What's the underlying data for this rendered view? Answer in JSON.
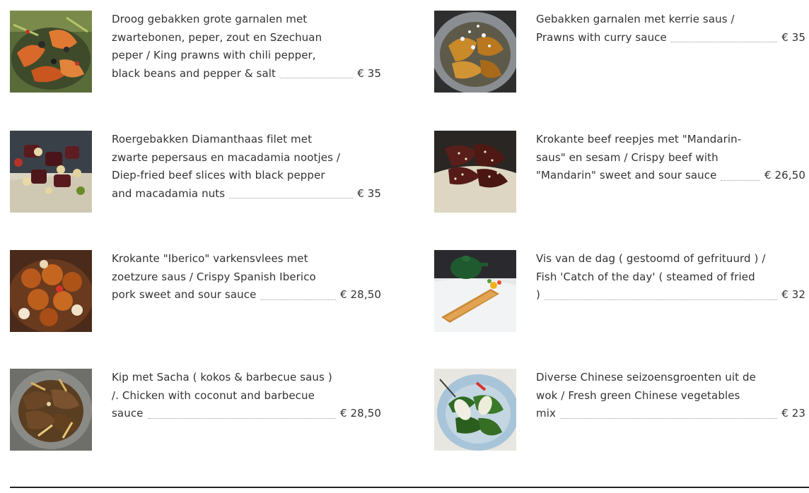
{
  "menu": {
    "items": [
      {
        "id": "garnalen-szechuan",
        "lines": [
          "Droog gebakken grote garnalen met",
          "zwartebonen, peper, zout en Szechuan",
          "peper / King prawns with chili pepper,"
        ],
        "last_line": "black beans and pepper & salt",
        "price": "€ 35",
        "image": "king-prawns-photo"
      },
      {
        "id": "garnalen-kerrie",
        "lines": [
          "Gebakken garnalen met kerrie saus /"
        ],
        "last_line": "Prawns with curry sauce",
        "price": "€ 35",
        "image": "curry-prawns-photo"
      },
      {
        "id": "diamanthaas",
        "lines": [
          "Roergebakken Diamanthaas filet met",
          "zwarte pepersaus en macadamia nootjes /",
          "Diep-fried beef slices with black pepper"
        ],
        "last_line": "and macadamia nuts",
        "price": "€ 35",
        "image": "beef-macadamia-photo"
      },
      {
        "id": "mandarin-beef",
        "lines": [
          "Krokante beef reepjes met \"Mandarin-",
          "saus\" en sesam / Crispy beef with"
        ],
        "last_line": "\"Mandarin\" sweet and sour sauce",
        "price": "€ 26,50",
        "image": "mandarin-beef-photo"
      },
      {
        "id": "iberico",
        "lines": [
          "Krokante \"Iberico\" varkensvlees met",
          "zoetzure saus / Crispy Spanish Iberico"
        ],
        "last_line": "pork sweet and sour sauce",
        "price": "€ 28,50",
        "image": "iberico-pork-photo"
      },
      {
        "id": "vis-van-de-dag",
        "lines": [
          "Vis van de dag ( gestoomd of gefrituurd ) /",
          "Fish 'Catch of the day' ( steamed of fried"
        ],
        "last_line": ")",
        "price": "€ 32",
        "image": "catch-of-the-day-photo"
      },
      {
        "id": "kip-sacha",
        "lines": [
          "Kip met Sacha ( kokos & barbecue saus )",
          "/. Chicken with coconut and barbecue"
        ],
        "last_line": "sauce",
        "price": "€ 28,50",
        "image": "sacha-chicken-photo"
      },
      {
        "id": "seizoensgroenten",
        "lines": [
          "Diverse Chinese seizoensgroenten uit de",
          "wok / Fresh green Chinese vegetables"
        ],
        "last_line": "mix",
        "price": "€ 23",
        "image": "chinese-vegetables-photo"
      }
    ]
  },
  "colors": {
    "text": "#333333",
    "leader_dots": "#9a9a9a",
    "rule": "#222222"
  }
}
